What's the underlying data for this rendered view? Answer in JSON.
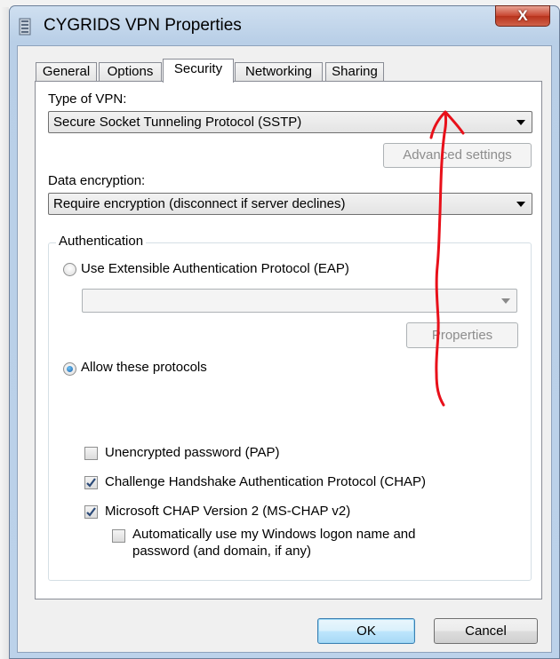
{
  "window": {
    "title": "CYGRIDS VPN Properties",
    "close_label": "X"
  },
  "tabs": [
    {
      "label": "General"
    },
    {
      "label": "Options"
    },
    {
      "label": "Security"
    },
    {
      "label": "Networking"
    },
    {
      "label": "Sharing"
    }
  ],
  "active_tab": "Security",
  "security": {
    "vpn_type_label": "Type of VPN:",
    "vpn_type_value": "Secure Socket Tunneling Protocol (SSTP)",
    "advanced_button": "Advanced settings",
    "encryption_label": "Data encryption:",
    "encryption_value": "Require encryption (disconnect if server declines)",
    "auth_group_title": "Authentication",
    "eap_radio": "Use Extensible Authentication Protocol (EAP)",
    "eap_value": "",
    "properties_button": "Properties",
    "allow_radio": "Allow these protocols",
    "protocols": [
      {
        "label": "Unencrypted password (PAP)",
        "checked": false
      },
      {
        "label": "Challenge Handshake Authentication Protocol (CHAP)",
        "checked": true
      },
      {
        "label": "Microsoft CHAP Version 2 (MS-CHAP v2)",
        "checked": true
      }
    ],
    "auto_logon_line1": "Automatically use my Windows logon name and",
    "auto_logon_line2": "password (and domain, if any)",
    "auto_logon_checked": false
  },
  "footer": {
    "ok_label": "OK",
    "cancel_label": "Cancel"
  },
  "annotation": {
    "color": "#e8101a"
  },
  "colors": {
    "title_bar": "#b9cfe7",
    "close_button": "#c7452f",
    "checkbox_mark": "#2b4a78"
  }
}
